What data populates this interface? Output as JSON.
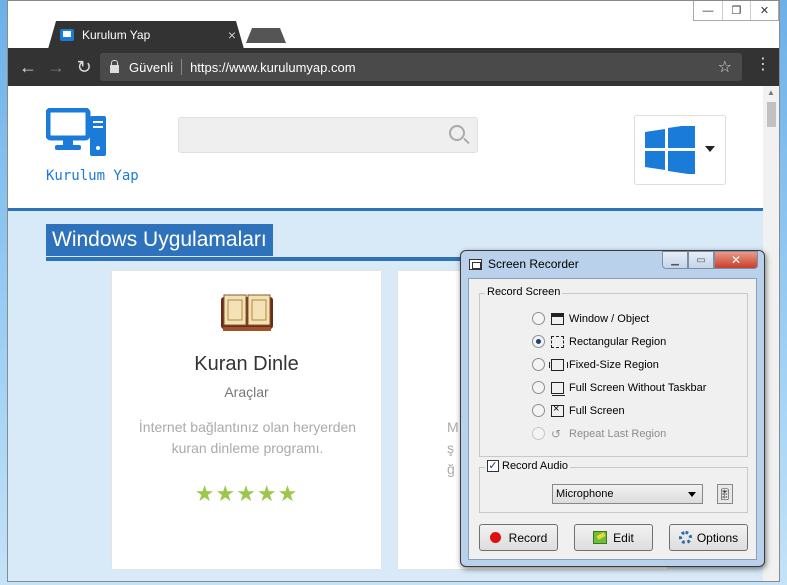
{
  "browser": {
    "tab_title": "Kurulum Yap",
    "tab_close": "×",
    "window_controls": [
      "—",
      "❐",
      "✕"
    ],
    "back": "←",
    "forward": "→",
    "reload": "↻",
    "secure_label": "Güvenli",
    "url": "https://www.kurulumyap.com",
    "bookmark": "☆",
    "menu": "⋮"
  },
  "site": {
    "logo_text": "Kurulum Yap",
    "search_placeholder": "",
    "section_title": "Windows Uygulamaları",
    "cards": [
      {
        "title": "Kuran Dinle",
        "category": "Araçlar",
        "description": "İnternet bağlantınız olan heryerden kuran dinleme programı.",
        "rating": 5,
        "stars": "★★★★★"
      },
      {
        "fragment_lines": [
          "M",
          "ş",
          "ğ"
        ]
      }
    ],
    "colors": {
      "brand": "#2e72bb",
      "logo_blue": "#1a7bd8",
      "stars": "#9bc84b"
    }
  },
  "dialog": {
    "title": "Screen Recorder",
    "close": "✕",
    "minimize": "▁",
    "maximize": "▭",
    "record_screen_label": "Record Screen",
    "options": [
      {
        "label": "Window / Object",
        "selected": false,
        "enabled": true
      },
      {
        "label": "Rectangular Region",
        "selected": true,
        "enabled": true
      },
      {
        "label": "Fixed-Size Region",
        "selected": false,
        "enabled": true
      },
      {
        "label": "Full Screen Without Taskbar",
        "selected": false,
        "enabled": true
      },
      {
        "label": "Full Screen",
        "selected": false,
        "enabled": true
      },
      {
        "label": "Repeat Last Region",
        "selected": false,
        "enabled": false
      }
    ],
    "record_audio_label": "Record Audio",
    "record_audio_checked": true,
    "audio_source": "Microphone",
    "buttons": {
      "record": "Record",
      "edit": "Edit",
      "options": "Options"
    }
  }
}
